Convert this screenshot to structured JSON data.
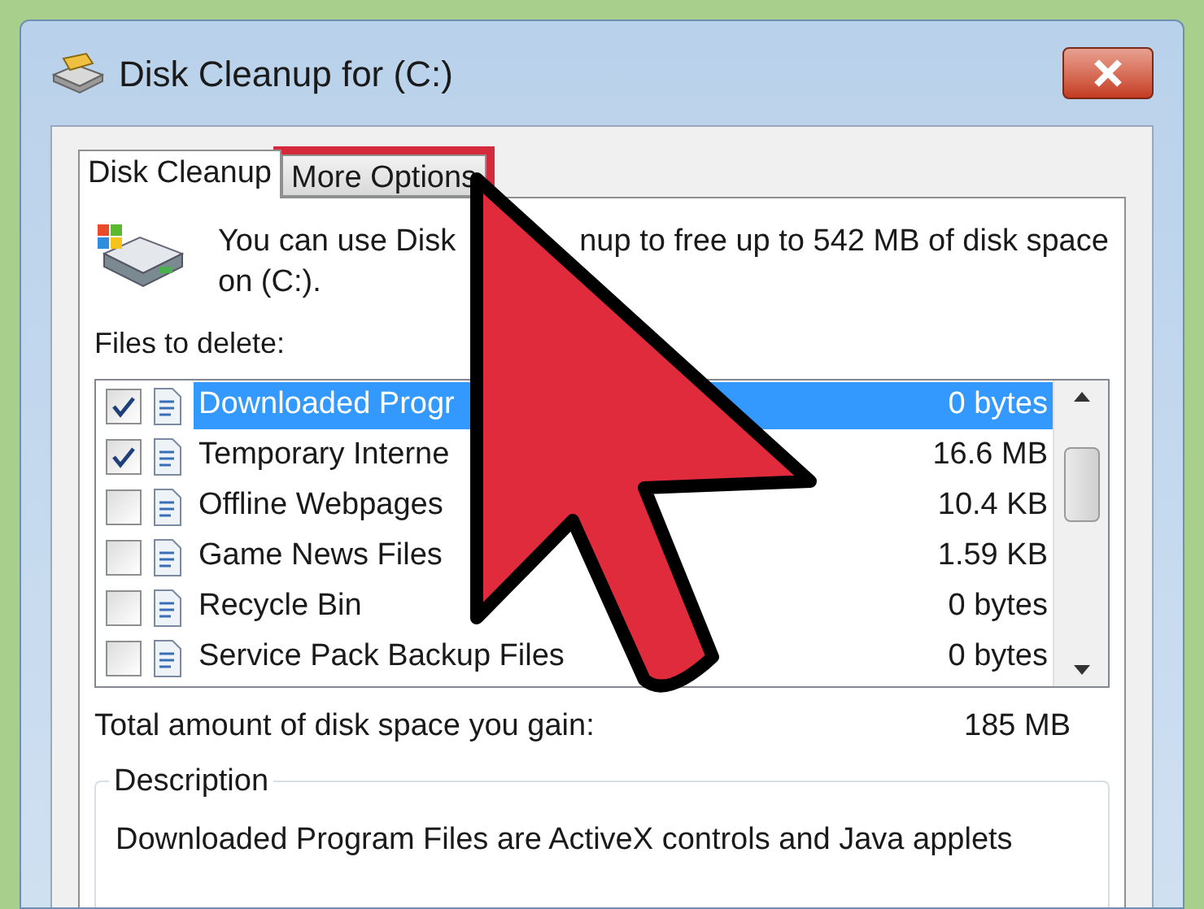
{
  "window": {
    "title": "Disk Cleanup for  (C:)"
  },
  "tabs": [
    {
      "label": "Disk Cleanup",
      "selected": true,
      "highlighted": false
    },
    {
      "label": "More Options",
      "selected": false,
      "highlighted": true
    }
  ],
  "intro": {
    "before": "You can use Disk",
    "after": "nup to free up to 542 MB of disk space",
    "line2": "on  (C:)."
  },
  "files_label": "Files to delete:",
  "files": [
    {
      "name": "Downloaded Progr",
      "size": "0 bytes",
      "checked": true,
      "selected": true
    },
    {
      "name": "Temporary Interne",
      "size": "16.6 MB",
      "checked": true,
      "selected": false
    },
    {
      "name": "Offline Webpages",
      "size": "10.4 KB",
      "checked": false,
      "selected": false
    },
    {
      "name": "Game News Files",
      "size": "1.59 KB",
      "checked": false,
      "selected": false
    },
    {
      "name": "Recycle Bin",
      "size": "0 bytes",
      "checked": false,
      "selected": false
    },
    {
      "name": "Service Pack Backup Files",
      "size": "0 bytes",
      "checked": false,
      "selected": false
    }
  ],
  "total": {
    "label": "Total amount of disk space you gain:",
    "value": "185 MB"
  },
  "description": {
    "title": "Description",
    "text": "Downloaded Program Files are ActiveX controls and Java applets"
  }
}
